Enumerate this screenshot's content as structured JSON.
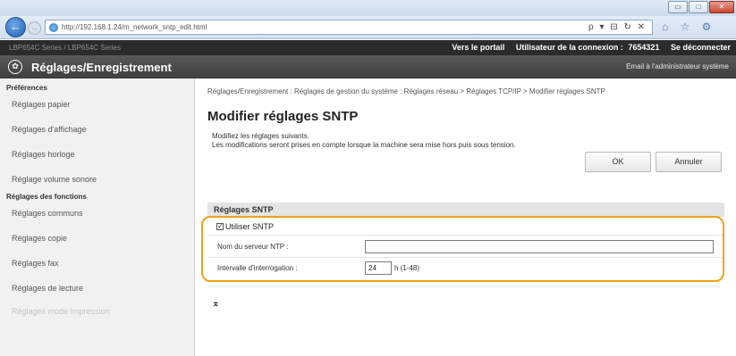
{
  "browser": {
    "url": "http://192.168.1.24/m_network_sntp_edit.html",
    "url_tail": "ρ ▾ ⊟ ↻ ✕",
    "window_buttons": [
      "▭",
      "□",
      "✕"
    ],
    "back_icon": "←",
    "forward_icon": "→",
    "toolbar_icons": "⌂ ☆ ⚙"
  },
  "topbar": {
    "device": "LBP654C  Series / LBP654C Series",
    "portal_link": "Vers le portail",
    "user_label": "Utilisateur de la connexion :",
    "user_id": "7654321",
    "logout": "Se déconnecter"
  },
  "header": {
    "icon": "✿",
    "title": "Réglages/Enregistrement",
    "admin_mail": "Email à l'administrateur système"
  },
  "sidebar": {
    "sections": [
      {
        "title": "Préférences",
        "items": [
          "Réglages papier",
          "Réglages d'affichage",
          "Réglages horloge",
          "Réglage volume sonore"
        ]
      },
      {
        "title": "Réglages des fonctions",
        "items": [
          "Réglages communs",
          "Réglages copie",
          "Réglages fax",
          "Réglages de lecture",
          "Réglages mode Impression"
        ]
      }
    ]
  },
  "main": {
    "breadcrumb": "Réglages/Enregistrement : Réglages de gestion du système : Réglages réseau > Réglages TCP/IP > Modifier réglages SNTP",
    "page_title": "Modifier réglages SNTP",
    "desc_line1": "Modifiez les réglages suivants.",
    "desc_line2": "Les modifications seront prises en compte lorsque la machine sera mise hors puis sous tension.",
    "ok_label": "OK",
    "cancel_label": "Annuler",
    "section_title": "Réglages SNTP",
    "use_sntp_label": "Utiliser SNTP",
    "use_sntp_checked": true,
    "check_mark": "✓",
    "ntp_server_label": "Nom du serveur NTP :",
    "ntp_server_value": "",
    "poll_label": "Intervalle d'interrogation :",
    "poll_value": "24",
    "poll_unit": "h (1-48)",
    "top_link_icon": "⌅"
  },
  "colors": {
    "highlight": "#f0a020",
    "header_bg": "#4a4a4a",
    "topbar_bg": "#2b2b2b"
  }
}
